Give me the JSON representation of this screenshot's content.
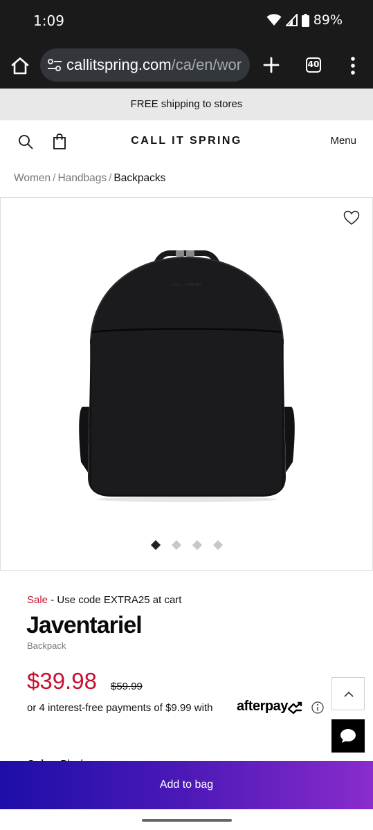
{
  "status": {
    "time": "1:09",
    "battery": "89%"
  },
  "browser": {
    "url_domain": "callitspring.com",
    "url_path": "/ca/en/wor",
    "tab_count": "40"
  },
  "promo": {
    "text": "FREE shipping to stores"
  },
  "header": {
    "brand": "CALL IT SPRING",
    "menu_label": "Menu"
  },
  "breadcrumb": {
    "items": [
      "Women",
      "Handbags",
      "Backpacks"
    ],
    "separator": "/"
  },
  "gallery": {
    "slide_count": 4,
    "active_slide": 1,
    "image_brand_print": "CALL IT SPRING"
  },
  "product": {
    "sale_label": "Sale",
    "sale_separator": "-",
    "sale_message": "Use code EXTRA25 at cart",
    "title": "Javentariel",
    "type": "Backpack",
    "price_now": "$39.98",
    "price_was": "$59.99",
    "installments_text": "or 4 interest-free payments of $9.99 with",
    "afterpay_logo": "afterpay",
    "color_label": "Color:",
    "color_value": "Black"
  },
  "actions": {
    "add_to_bag": "Add to bag"
  },
  "icons": [
    "home-icon",
    "site-settings-icon",
    "plus-icon",
    "tab-switcher-icon",
    "more-vert-icon",
    "search-icon",
    "shopping-bag-icon",
    "heart-icon",
    "info-icon",
    "chevron-up-icon",
    "chat-icon"
  ],
  "colors": {
    "sale_red": "#c8102e",
    "cta_gradient_start": "#1d0ea8",
    "cta_gradient_end": "#8a2ccc",
    "browser_chrome": "#1a1a1a",
    "promo_bg": "#e8e8e8"
  }
}
